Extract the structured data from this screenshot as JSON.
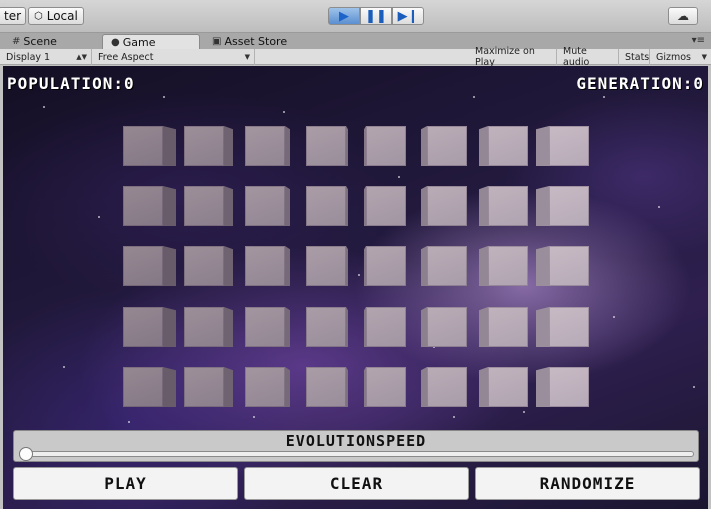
{
  "toolbar": {
    "pivot_label": "ter",
    "local_label": "Local",
    "play_icon": "play-icon",
    "pause_icon": "pause-icon",
    "step_icon": "step-icon",
    "cloud_icon": "cloud-icon"
  },
  "tabs": [
    {
      "label": "Scene",
      "icon": "hash-icon"
    },
    {
      "label": "Game",
      "icon": "gamepad-icon"
    },
    {
      "label": "Asset Store",
      "icon": "store-icon"
    }
  ],
  "options": {
    "display": "Display 1",
    "aspect": "Free Aspect",
    "maximize": "Maximize on Play",
    "mute": "Mute audio",
    "stats": "Stats",
    "gizmos": "Gizmos"
  },
  "hud": {
    "population": "POPULATION:0",
    "generation": "GENERATION:0"
  },
  "grid": {
    "rows": 5,
    "cols": 8
  },
  "controls": {
    "speed_label": "EVOLUTIONSPEED",
    "speed_value": 0,
    "play": "PLAY",
    "clear": "CLEAR",
    "randomize": "RANDOMIZE"
  }
}
